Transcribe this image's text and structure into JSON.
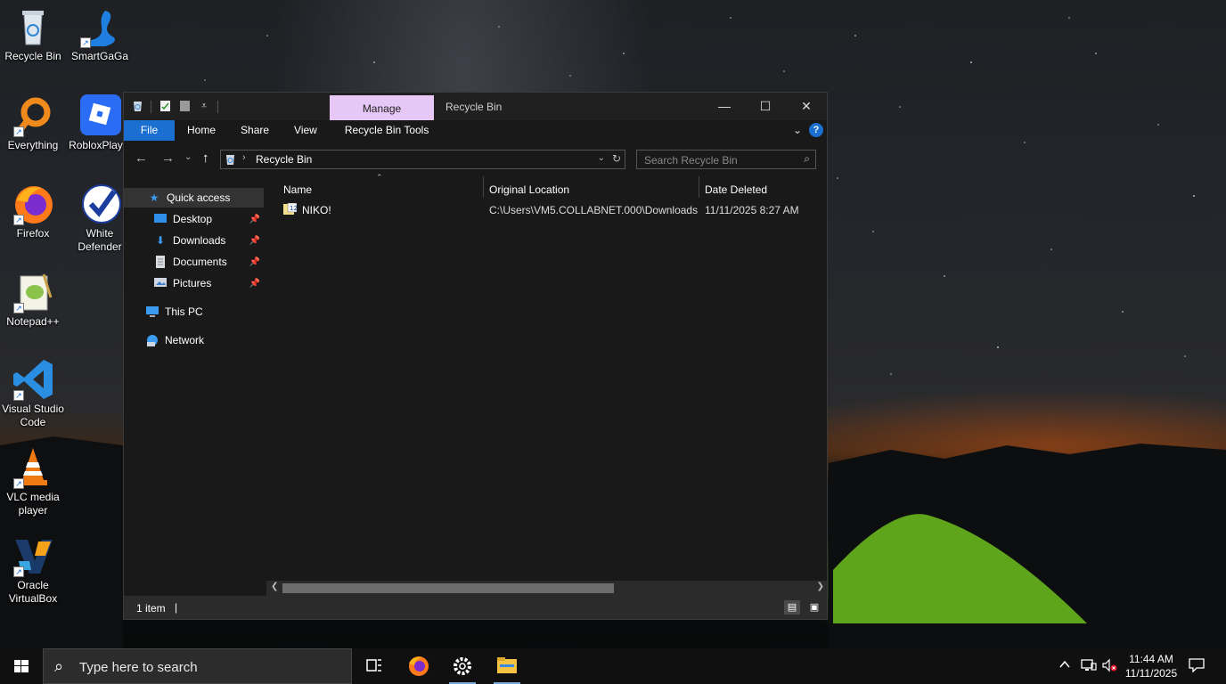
{
  "desktop": {
    "icons": [
      {
        "label": "Recycle Bin"
      },
      {
        "label": "SmartGaGa"
      },
      {
        "label": "Everything"
      },
      {
        "label": "RobloxPlay..."
      },
      {
        "label": "Firefox"
      },
      {
        "label": "White Defender"
      },
      {
        "label": "Notepad++"
      },
      {
        "label": "Visual Studio Code"
      },
      {
        "label": "VLC media player"
      },
      {
        "label": "Oracle VirtualBox"
      }
    ]
  },
  "window": {
    "title": "Recycle Bin",
    "context_tab": "Manage",
    "controls": {
      "minimize": "—",
      "maximize": "☐",
      "close": "✕"
    },
    "ribbon": {
      "tabs": [
        "File",
        "Home",
        "Share",
        "View",
        "Recycle Bin Tools"
      ],
      "help": "?"
    },
    "nav": {
      "back": "←",
      "forward": "→",
      "recent": "⌄",
      "up": "↑"
    },
    "address": {
      "path": "Recycle Bin",
      "separator": "›"
    },
    "search": {
      "placeholder": "Search Recycle Bin"
    },
    "navpane": {
      "quick_access": "Quick access",
      "items": [
        {
          "label": "Desktop",
          "pinned": true
        },
        {
          "label": "Downloads",
          "pinned": true
        },
        {
          "label": "Documents",
          "pinned": true
        },
        {
          "label": "Pictures",
          "pinned": true
        }
      ],
      "this_pc": "This PC",
      "network": "Network"
    },
    "columns": [
      "Name",
      "Original Location",
      "Date Deleted"
    ],
    "rows": [
      {
        "name": "NIKO!",
        "original_location": "C:\\Users\\VM5.COLLABNET.000\\Downloads",
        "date_deleted": "11/11/2025 8:27 AM"
      }
    ],
    "status": {
      "count": "1 item"
    }
  },
  "taskbar": {
    "search_placeholder": "Type here to search",
    "time": "11:44 AM",
    "date": "11/11/2025"
  },
  "colors": {
    "accent": "#1a6fd1",
    "manage_tab": "#e6c7f5",
    "window_bg": "#191919"
  }
}
